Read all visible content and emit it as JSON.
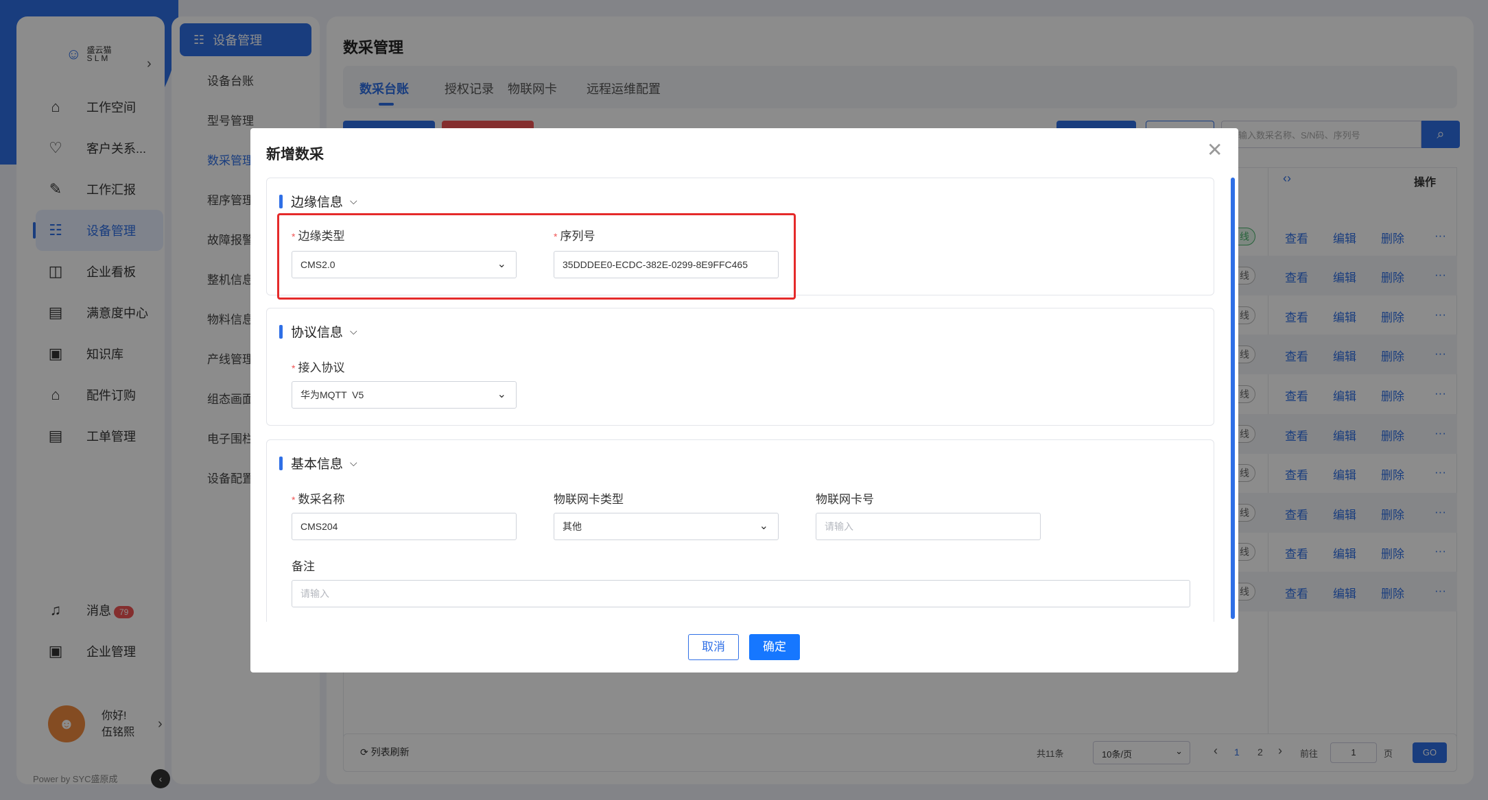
{
  "sidebar": {
    "logo_text": "盛云猫\nS L M",
    "items": [
      {
        "label": "工作空间",
        "icon": "home-icon"
      },
      {
        "label": "客户关系...",
        "icon": "crm-icon"
      },
      {
        "label": "工作汇报",
        "icon": "report-icon"
      },
      {
        "label": "设备管理",
        "icon": "device-icon"
      },
      {
        "label": "企业看板",
        "icon": "dashboard-icon"
      },
      {
        "label": "满意度中心",
        "icon": "satisfaction-icon"
      },
      {
        "label": "知识库",
        "icon": "knowledge-icon"
      },
      {
        "label": "配件订购",
        "icon": "parts-icon"
      },
      {
        "label": "工单管理",
        "icon": "ticket-icon"
      }
    ],
    "message_label": "消息",
    "message_count": "79",
    "enterprise_label": "企业管理",
    "greeting": "你好!",
    "user_name": "伍铭熙",
    "powered": "Power by SYC盛原成"
  },
  "subnav": {
    "header": "设备管理",
    "items": [
      "设备台账",
      "型号管理",
      "数采管理",
      "程序管理",
      "故障报警",
      "整机信息",
      "物料信息",
      "产线管理",
      "组态画面",
      "电子围栏",
      "设备配置"
    ]
  },
  "main": {
    "title": "数采管理",
    "tabs": [
      "数采台账",
      "授权记录",
      "物联网卡",
      "远程运维配置"
    ],
    "search_placeholder": "输入数采名称、S/N码、序列号",
    "op_header": "操作",
    "row_actions": [
      "查看",
      "编辑",
      "删除",
      "···"
    ],
    "status_online": "线",
    "status_offline": "线",
    "footer": {
      "refresh": "列表刷新",
      "total": "共11条",
      "page_size": "10条/页",
      "page1": "1",
      "page2": "2",
      "goto": "前往",
      "goto_value": "1",
      "page_unit": "页",
      "go": "GO"
    }
  },
  "modal": {
    "title": "新增数采",
    "sections": {
      "edge": {
        "title": "边缘信息",
        "type_label": "边缘类型",
        "type_value": "CMS2.0",
        "serial_label": "序列号",
        "serial_value": "35DDDEE0-ECDC-382E-0299-8E9FFC465"
      },
      "protocol": {
        "title": "协议信息",
        "access_label": "接入协议",
        "access_value": "华为MQTT  V5"
      },
      "basic": {
        "title": "基本信息",
        "name_label": "数采名称",
        "name_value": "CMS204",
        "card_type_label": "物联网卡类型",
        "card_type_value": "其他",
        "card_no_label": "物联网卡号",
        "card_no_placeholder": "请输入",
        "remark_label": "备注",
        "remark_placeholder": "请输入"
      }
    },
    "cancel": "取消",
    "ok": "确定"
  },
  "colors": {
    "primary": "#2f6fe6",
    "highlight": "#e52a2a"
  }
}
